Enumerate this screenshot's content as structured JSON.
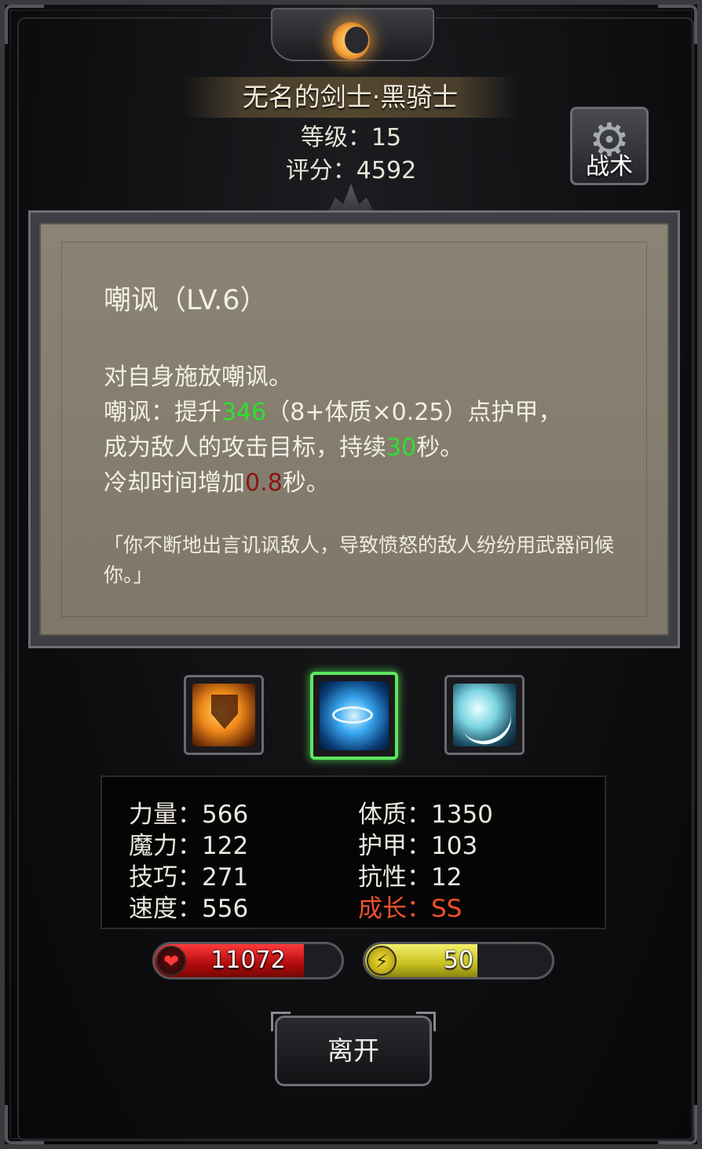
{
  "character": {
    "name": "无名的剑士·黑骑士",
    "level_text": "等级：15",
    "score_text": "评分：4592"
  },
  "tactics_button": {
    "label": "战术",
    "icon": "gear-icon"
  },
  "skill_detail": {
    "title": "嘲讽（LV.6）",
    "line1": "对自身施放嘲讽。",
    "line2_prefix": "嘲讽：提升",
    "line2_value": "346",
    "line2_suffix": "（8+体质×0.25）点护甲，",
    "line3_prefix": "成为敌人的攻击目标，持续",
    "line3_value": "30",
    "line3_suffix": "秒。",
    "line4_prefix": "冷却时间增加",
    "line4_value": "0.8",
    "line4_suffix": "秒。",
    "quote": "「你不断地出言讥讽敌人，导致愤怒的敌人纷纷用武器问候你。」",
    "colors": {
      "highlight_green": "#2ee02e",
      "highlight_red": "#8b1414"
    }
  },
  "skills": [
    {
      "icon": "fire-shield-icon",
      "selected": false
    },
    {
      "icon": "eye-icon",
      "selected": true
    },
    {
      "icon": "slash-icon",
      "selected": false
    }
  ],
  "stats": {
    "strength": "力量：566",
    "magic": "魔力：122",
    "skill": "技巧：271",
    "speed": "速度：556",
    "constitution": "体质：1350",
    "armor": "护甲：103",
    "resistance": "抗性：12",
    "growth": "成长：SS",
    "growth_color": "#f0502a"
  },
  "hp_bar": {
    "value": "11072",
    "fill_percent": 80,
    "icon": "heart-icon"
  },
  "energy_bar": {
    "value": "50",
    "fill_percent": 60,
    "icon": "lightning-icon"
  },
  "leave_button": {
    "label": "离开"
  }
}
